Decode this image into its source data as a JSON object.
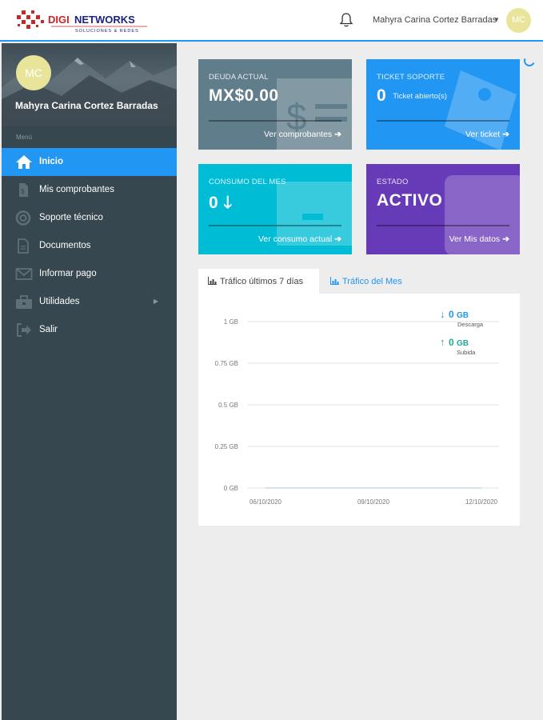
{
  "header": {
    "logo_text": "DIGINETWORKS",
    "logo_tagline": "SOLUCIONES & REDES",
    "user_name": "Mahyra Carina Cortez Barradas",
    "avatar_initials": "MC"
  },
  "sidebar": {
    "avatar_initials": "MC",
    "user_name": "Mahyra Carina Cortez Barradas",
    "menu_label": "Menú",
    "items": [
      {
        "label": "Inicio",
        "icon": "home-icon",
        "active": true
      },
      {
        "label": "Mis comprobantes",
        "icon": "receipt-icon"
      },
      {
        "label": "Soporte técnico",
        "icon": "lifebuoy-icon"
      },
      {
        "label": "Documentos",
        "icon": "document-icon"
      },
      {
        "label": "Informar pago",
        "icon": "envelope-icon"
      },
      {
        "label": "Utilidades",
        "icon": "toolbox-icon",
        "has_submenu": true
      },
      {
        "label": "Salir",
        "icon": "sign-out-icon"
      }
    ]
  },
  "cards": {
    "deuda": {
      "title": "DEUDA ACTUAL",
      "value": "MX$0.00",
      "link": "Ver comprobantes",
      "color": "#607d8b"
    },
    "ticket": {
      "title": "TICKET SOPORTE",
      "value": "0",
      "sub": "Ticket abierto(s)",
      "link": "Ver ticket",
      "color": "#2196f3"
    },
    "consumo": {
      "title": "CONSUMO DEL MES",
      "value": "0",
      "link": "Ver consumo actual",
      "color": "#00bcd4"
    },
    "estado": {
      "title": "ESTADO",
      "value": "ACTIVO",
      "link": "Ver Mis datos",
      "color": "#673ab7"
    }
  },
  "tabs": [
    {
      "label": "Tráfico últimos 7 días",
      "active": true
    },
    {
      "label": "Tráfico del Mes",
      "active": false
    }
  ],
  "chart_data": {
    "type": "line",
    "y_ticks": [
      "1 GB",
      "0.75 GB",
      "0.5 GB",
      "0.25 GB",
      "0 GB"
    ],
    "ylim": [
      0,
      1
    ],
    "x_ticks": [
      "06/10/2020",
      "09/10/2020",
      "12/10/2020"
    ],
    "series": [
      {
        "name": "Descarga",
        "value": "0",
        "unit": "GB",
        "color": "#2196f3"
      },
      {
        "name": "Subida",
        "value": "0",
        "unit": "GB",
        "color": "#26a69a"
      }
    ],
    "grid": true,
    "legend_position": "top-right"
  }
}
